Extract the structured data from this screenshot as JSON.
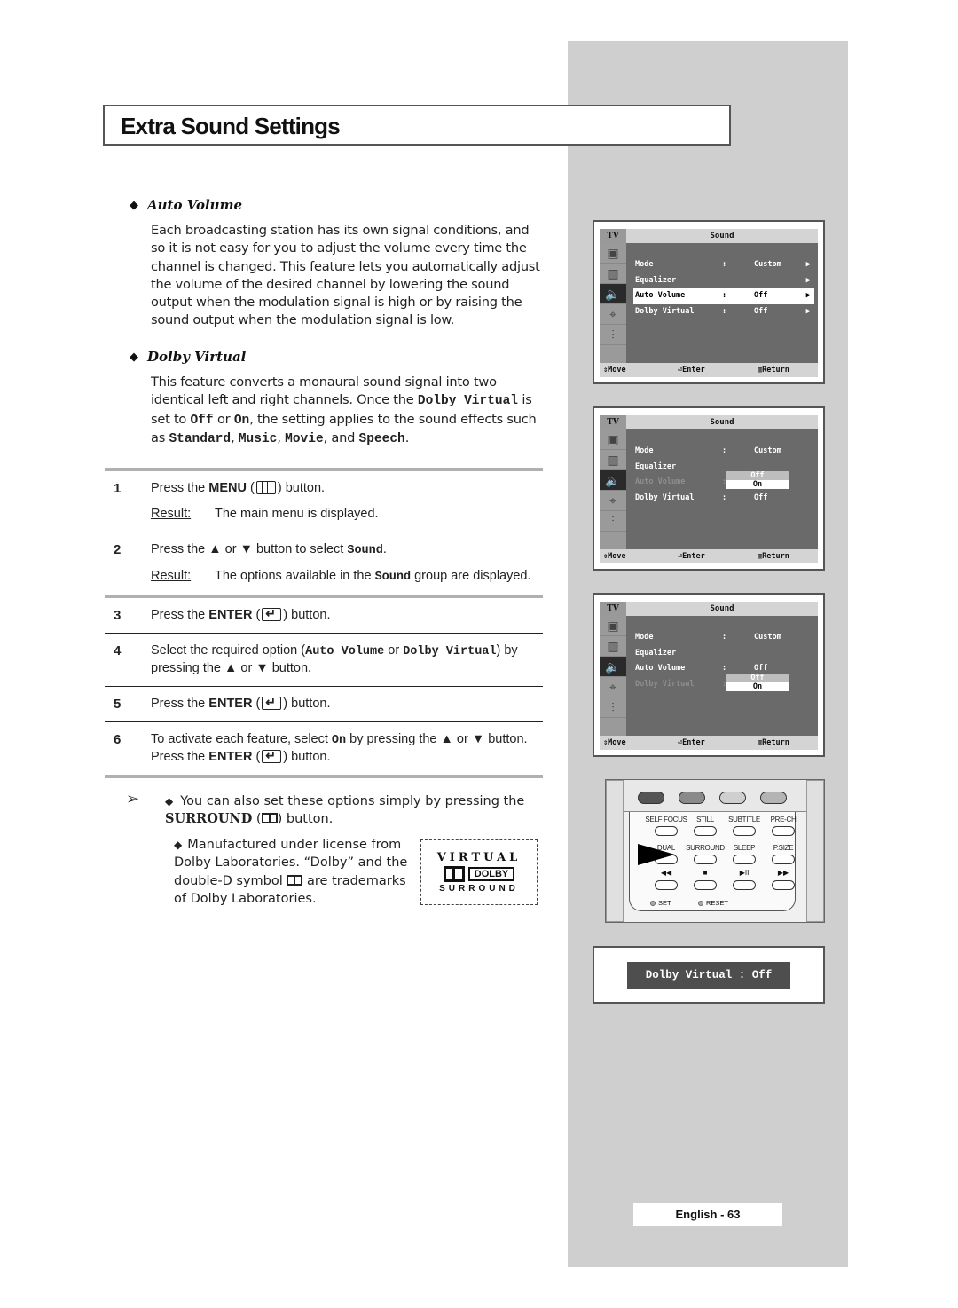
{
  "page": {
    "title": "Extra Sound Settings",
    "page_number": "English - 63"
  },
  "features": [
    {
      "heading": "Auto Volume",
      "body": "Each broadcasting station has its own signal conditions, and so it is not easy for you to adjust the volume every time the channel is changed. This feature lets you automatically adjust the volume of the desired channel by lowering the sound output when the modulation signal is high or by raising the sound output when the modulation signal is low."
    },
    {
      "heading": "Dolby Virtual",
      "body_parts": {
        "p1": "This feature converts a monaural sound signal into two identical left and right channels. Once the ",
        "k1": "Dolby Virtual",
        "p2": " is set to ",
        "k2": "Off",
        "p3": "  or ",
        "k3": "On",
        "p4": ", the setting applies to the sound effects such as ",
        "k4": "Standard",
        "p5": ", ",
        "k5": "Music",
        "p6": ", ",
        "k6": "Movie",
        "p7": ", and ",
        "k7": "Speech",
        "p8": "."
      }
    }
  ],
  "steps": [
    {
      "num": "1",
      "a": "Press the ",
      "b": "MENU",
      "c": " (",
      "d": ")  button.",
      "result_label": "Result:",
      "result": "The main menu is displayed."
    },
    {
      "num": "2",
      "a": "Press the ▲ or ▼ button to select ",
      "m": "Sound",
      "c": ".",
      "result_label": "Result:",
      "result_a": "The options available in the ",
      "result_m": "Sound",
      "result_b": " group are displayed."
    },
    {
      "num": "3",
      "a": "Press the ",
      "b": "ENTER",
      "c": " (",
      "d": ") button."
    },
    {
      "num": "4",
      "a": "Select the required option (",
      "m1": "Auto Volume",
      "or": " or ",
      "m2": "Dolby Virtual",
      "c": ") by pressing the ▲ or ▼ button."
    },
    {
      "num": "5",
      "a": "Press the ",
      "b": "ENTER",
      "c": " (",
      "d": ") button."
    },
    {
      "num": "6",
      "a": "To activate each feature, select ",
      "m": "On",
      "c": " by pressing the ▲ or ▼ button. Press the ",
      "b": "ENTER",
      "e": " (",
      "d": ") button."
    }
  ],
  "notes": {
    "arrow": "➢",
    "tip_a": "You can also set these options simply by pressing the ",
    "tip_b": "SURROUND",
    "tip_c": " (",
    "tip_d": ") button.",
    "license_a": "Manufactured under license from Dolby Laboratories. “Dolby” and the double-D symbol ",
    "license_b": " are trademarks of Dolby Laboratories."
  },
  "dolby_logo": {
    "top": "VIRTUAL",
    "word": "DOLBY",
    "bottom": "SURROUND"
  },
  "osd_screens": [
    {
      "tv_label": "TV",
      "title": "Sound",
      "rows": [
        {
          "label": "Mode",
          "colon": ":",
          "value": "Custom",
          "arrow": "▶"
        },
        {
          "label": "Equalizer",
          "colon": "",
          "value": "",
          "arrow": "▶"
        },
        {
          "label": "Auto Volume",
          "colon": ":",
          "value": "Off",
          "arrow": "▶"
        },
        {
          "label": "Dolby Virtual",
          "colon": ":",
          "value": "Off",
          "arrow": "▶"
        }
      ],
      "footer": {
        "move": "Move",
        "enter": "Enter",
        "return": "Return"
      }
    },
    {
      "tv_label": "TV",
      "title": "Sound",
      "rows": [
        {
          "label": "Mode",
          "colon": ":",
          "value": "Custom"
        },
        {
          "label": "Equalizer",
          "colon": "",
          "value": ""
        },
        {
          "label": "Auto Volume",
          "colon": ":",
          "value": ""
        },
        {
          "label": "Dolby Virtual",
          "colon": ":",
          "value": "Off"
        }
      ],
      "dropdown": [
        "Off",
        "On"
      ],
      "footer": {
        "move": "Move",
        "enter": "Enter",
        "return": "Return"
      }
    },
    {
      "tv_label": "TV",
      "title": "Sound",
      "rows": [
        {
          "label": "Mode",
          "colon": ":",
          "value": "Custom"
        },
        {
          "label": "Equalizer",
          "colon": "",
          "value": ""
        },
        {
          "label": "Auto Volume",
          "colon": ":",
          "value": "Off"
        },
        {
          "label": "Dolby Virtual",
          "colon": ":",
          "value": ""
        }
      ],
      "dropdown": [
        "Off",
        "On"
      ],
      "footer": {
        "move": "Move",
        "enter": "Enter",
        "return": "Return"
      }
    }
  ],
  "remote": {
    "labels_row1": [
      "SELF FOCUS",
      "STILL",
      "SUBTITLE",
      "PRE-CH"
    ],
    "labels_row2": [
      "DUAL",
      "SURROUND",
      "SLEEP",
      "P.SIZE"
    ],
    "transport": [
      "◀◀",
      "■",
      "▶II",
      "▶▶"
    ],
    "set": "SET",
    "reset": "RESET",
    "color_buttons": [
      "#555555",
      "#8a8a8a",
      "#cfcfcf",
      "#b4b4b4"
    ]
  },
  "dolby_status": "Dolby Virtual : Off"
}
